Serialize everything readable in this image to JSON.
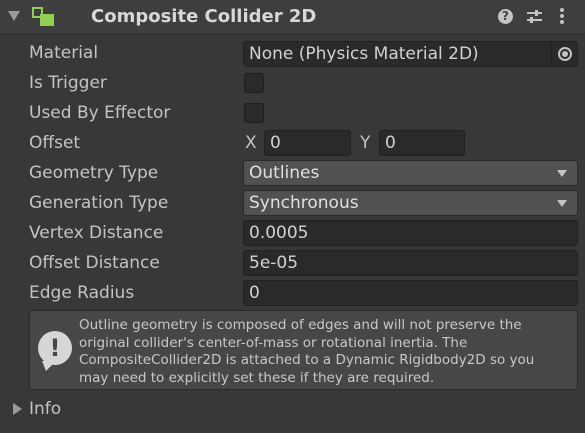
{
  "header": {
    "title": "Composite Collider 2D",
    "help_glyph": "?",
    "icons": [
      "foldout-arrow-icon",
      "composite-collider-icon",
      "help-icon",
      "presets-icon",
      "more-options-icon"
    ],
    "accent_color": "#8fd14f"
  },
  "fields": {
    "material": {
      "label": "Material",
      "value": "None (Physics Material 2D)"
    },
    "is_trigger": {
      "label": "Is Trigger",
      "checked": false
    },
    "used_by_effector": {
      "label": "Used By Effector",
      "checked": false
    },
    "offset": {
      "label": "Offset",
      "x_label": "X",
      "x_value": "0",
      "y_label": "Y",
      "y_value": "0"
    },
    "geometry_type": {
      "label": "Geometry Type",
      "value": "Outlines"
    },
    "generation_type": {
      "label": "Generation Type",
      "value": "Synchronous"
    },
    "vertex_distance": {
      "label": "Vertex Distance",
      "value": "0.0005"
    },
    "offset_distance": {
      "label": "Offset Distance",
      "value": "5e-05"
    },
    "edge_radius": {
      "label": "Edge Radius",
      "value": "0"
    }
  },
  "help_box": {
    "icon": "warning-icon",
    "glyph": "!",
    "line1": "Outline geometry is composed of edges and will not preserve the",
    "line2": "original collider's center-of-mass or rotational inertia.  The",
    "line3": "CompositeCollider2D is attached to a Dynamic Rigidbody2D so you",
    "line4": "may need to explicitly set these if they are required."
  },
  "info": {
    "label": "Info",
    "expanded": false
  }
}
